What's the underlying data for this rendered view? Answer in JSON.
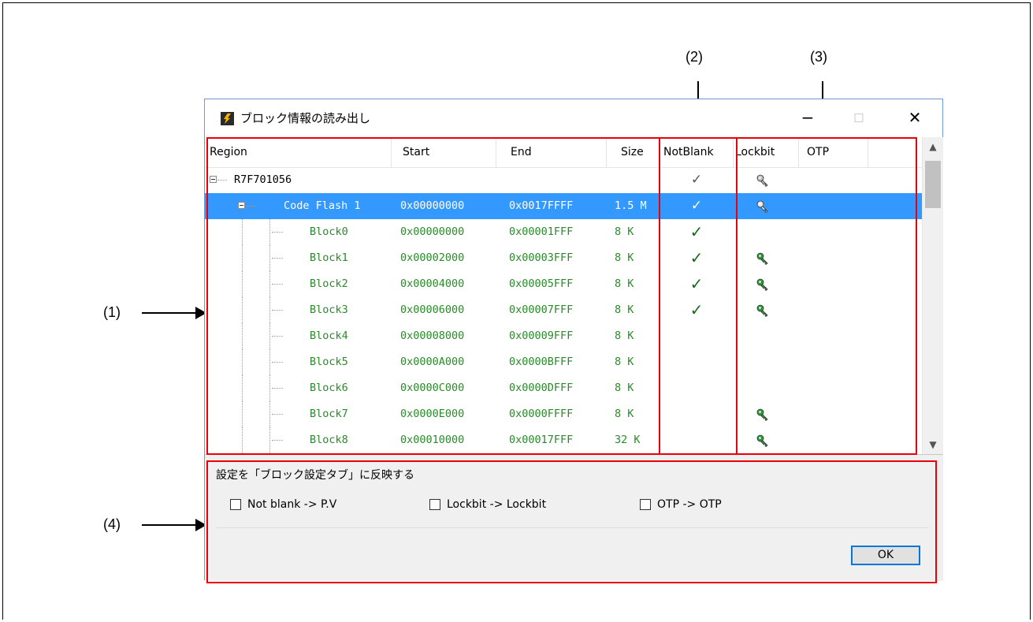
{
  "callouts": {
    "c1": "(1)",
    "c2": "(2)",
    "c3": "(3)",
    "c4": "(4)"
  },
  "window": {
    "title": "ブロック情報の読み出し",
    "minimize": "−",
    "maximize": "□",
    "close": "✕"
  },
  "columns": {
    "region": "Region",
    "start": "Start",
    "end": "End",
    "size": "Size",
    "notblank": "NotBlank",
    "lockbit": "Lockbit",
    "otp": "OTP"
  },
  "rows": [
    {
      "region": "R7F701056",
      "start": "",
      "end": "",
      "size": "",
      "notblank": "thin",
      "lockbit": "gray",
      "level": 0,
      "color": "black"
    },
    {
      "region": "Code Flash 1",
      "start": "0x00000000",
      "end": "0x0017FFFF",
      "size": "1.5 M",
      "notblank": "thin",
      "lockbit": "gray",
      "level": 1,
      "color": "white",
      "selected": true
    },
    {
      "region": "Block0",
      "start": "0x00000000",
      "end": "0x00001FFF",
      "size": "8 K",
      "notblank": "bold",
      "lockbit": "",
      "level": 2,
      "color": "green"
    },
    {
      "region": "Block1",
      "start": "0x00002000",
      "end": "0x00003FFF",
      "size": "8 K",
      "notblank": "bold",
      "lockbit": "green",
      "level": 2,
      "color": "green"
    },
    {
      "region": "Block2",
      "start": "0x00004000",
      "end": "0x00005FFF",
      "size": "8 K",
      "notblank": "bold",
      "lockbit": "green",
      "level": 2,
      "color": "green"
    },
    {
      "region": "Block3",
      "start": "0x00006000",
      "end": "0x00007FFF",
      "size": "8 K",
      "notblank": "bold",
      "lockbit": "green",
      "level": 2,
      "color": "green"
    },
    {
      "region": "Block4",
      "start": "0x00008000",
      "end": "0x00009FFF",
      "size": "8 K",
      "notblank": "",
      "lockbit": "",
      "level": 2,
      "color": "green"
    },
    {
      "region": "Block5",
      "start": "0x0000A000",
      "end": "0x0000BFFF",
      "size": "8 K",
      "notblank": "",
      "lockbit": "",
      "level": 2,
      "color": "green"
    },
    {
      "region": "Block6",
      "start": "0x0000C000",
      "end": "0x0000DFFF",
      "size": "8 K",
      "notblank": "",
      "lockbit": "",
      "level": 2,
      "color": "green"
    },
    {
      "region": "Block7",
      "start": "0x0000E000",
      "end": "0x0000FFFF",
      "size": "8 K",
      "notblank": "",
      "lockbit": "green",
      "level": 2,
      "color": "green"
    },
    {
      "region": "Block8",
      "start": "0x00010000",
      "end": "0x00017FFF",
      "size": "32 K",
      "notblank": "",
      "lockbit": "green",
      "level": 2,
      "color": "green"
    }
  ],
  "panel": {
    "title": "設定を「ブロック設定タブ」に反映する",
    "checkboxes": [
      "Not blank -> P.V",
      "Lockbit -> Lockbit",
      "OTP -> OTP"
    ],
    "ok": "OK"
  },
  "colors": {
    "highlight": "#e8000b",
    "selection": "#3399ff",
    "block_text": "#2a8a2a"
  }
}
